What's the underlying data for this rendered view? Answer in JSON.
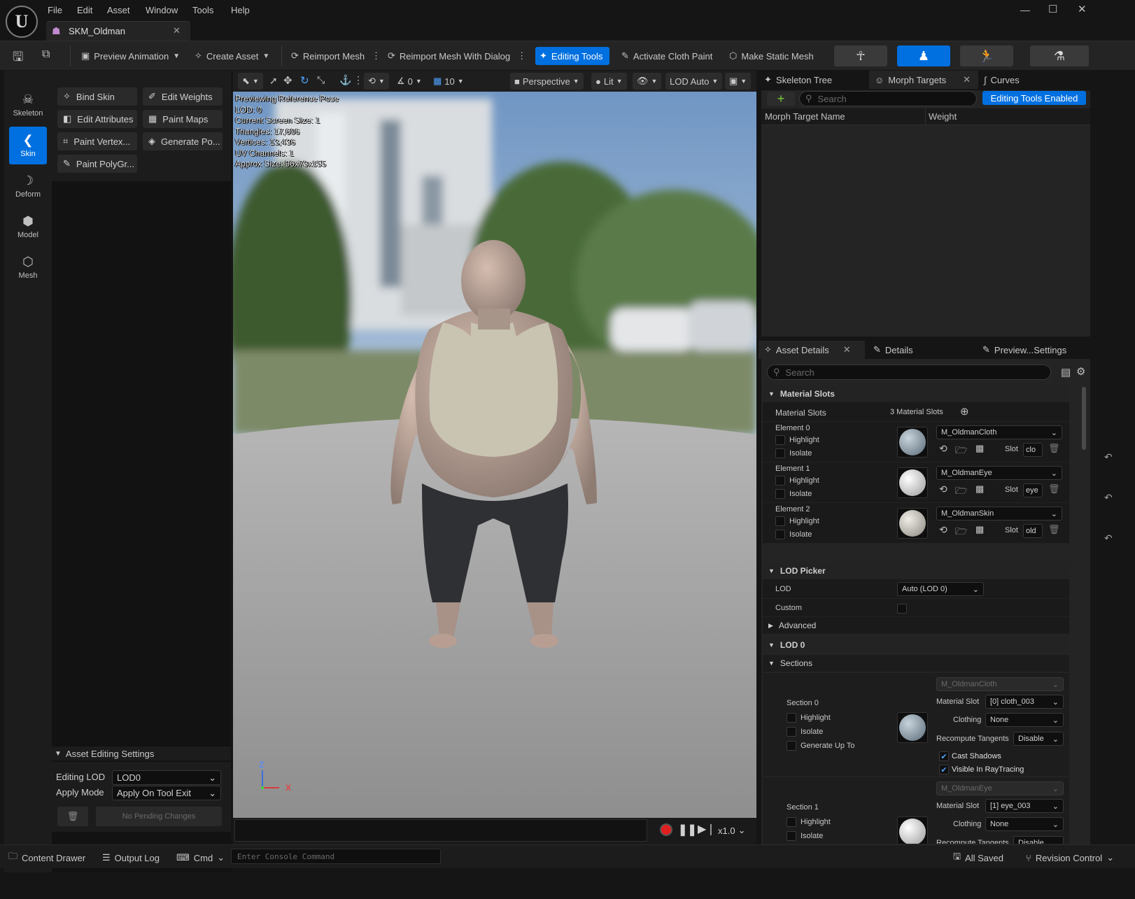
{
  "menu": [
    "File",
    "Edit",
    "Asset",
    "Window",
    "Tools",
    "Help"
  ],
  "window": {
    "tab_title": "SKM_Oldman"
  },
  "toolbar": {
    "preview_animation": "Preview Animation",
    "create_asset": "Create Asset",
    "reimport_mesh": "Reimport Mesh",
    "reimport_mesh_dialog": "Reimport Mesh With Dialog",
    "editing_tools": "Editing Tools",
    "activate_cloth_paint": "Activate Cloth Paint",
    "make_static_mesh": "Make Static Mesh"
  },
  "modes": [
    "Skeleton",
    "Skin",
    "Deform",
    "Model",
    "Mesh"
  ],
  "tools": [
    "Bind Skin",
    "Edit Weights",
    "Edit Attributes",
    "Paint Maps",
    "Paint Vertex...",
    "Generate Po...",
    "Paint PolyGr..."
  ],
  "asset_editing": {
    "header": "Asset Editing Settings",
    "editing_lod_label": "Editing LOD",
    "editing_lod_value": "LOD0",
    "apply_mode_label": "Apply Mode",
    "apply_mode_value": "Apply On Tool Exit",
    "pending": "No Pending Changes"
  },
  "viewport": {
    "snap_value": "0",
    "grid_value": "10",
    "perspective": "Perspective",
    "lit": "Lit",
    "lod": "LOD Auto",
    "stats": [
      "Previewing Reference Pose",
      "LOD: 0",
      "Current Screen Size: 1",
      "Triangles: 17,606",
      "Vertices: 13,436",
      "UV Channels: 1",
      "Approx Size: 96x73x155"
    ],
    "axis_z": "Z",
    "axis_x": "X",
    "speed": "x1.0"
  },
  "right_tabs": {
    "skeleton_tree": "Skeleton Tree",
    "morph_targets": "Morph Targets",
    "curves": "Curves",
    "search_placeholder": "Search",
    "editing_enabled": "Editing Tools Enabled",
    "col_name": "Morph Target Name",
    "col_weight": "Weight"
  },
  "details_tabs": {
    "asset_details": "Asset Details",
    "details": "Details",
    "preview_settings": "Preview...Settings",
    "search_placeholder": "Search"
  },
  "material_slots": {
    "header": "Material Slots",
    "label": "Material Slots",
    "count": "3 Material Slots",
    "elements": [
      {
        "name": "Element 0",
        "material": "M_OldmanCloth",
        "slot": "clo",
        "color": "#8a9aa8"
      },
      {
        "name": "Element 1",
        "material": "M_OldmanEye",
        "slot": "eye",
        "color": "#d8d8d8"
      },
      {
        "name": "Element 2",
        "material": "M_OldmanSkin",
        "slot": "old",
        "color": "#c8c8c0"
      }
    ],
    "highlight": "Highlight",
    "isolate": "Isolate",
    "slot_label": "Slot"
  },
  "lod_picker": {
    "header": "LOD Picker",
    "lod_label": "LOD",
    "lod_value": "Auto (LOD 0)",
    "custom_label": "Custom"
  },
  "advanced": "Advanced",
  "lod0": {
    "header": "LOD 0",
    "sections_label": "Sections",
    "sections": [
      {
        "name": "Section 0",
        "material": "M_OldmanCloth",
        "material_slot": "[0] cloth_003",
        "clothing": "None",
        "recompute": "Disable",
        "color": "#8a9aa8"
      },
      {
        "name": "Section 1",
        "material": "M_OldmanEye",
        "material_slot": "[1] eye_003",
        "clothing": "None",
        "recompute": "Disable",
        "color": "#d8d8d8"
      }
    ],
    "highlight": "Highlight",
    "isolate": "Isolate",
    "generate": "Generate Up To",
    "material_slot_label": "Material Slot",
    "clothing_label": "Clothing",
    "recompute_label": "Recompute Tangents",
    "cast_shadows": "Cast Shadows",
    "visible_raytracing": "Visible In RayTracing"
  },
  "status": {
    "content_drawer": "Content Drawer",
    "output_log": "Output Log",
    "cmd": "Cmd",
    "console_placeholder": "Enter Console Command",
    "all_saved": "All Saved",
    "revision_control": "Revision Control"
  },
  "colors": {
    "accent": "#0070e0",
    "background": "#151515",
    "panel": "#242424"
  }
}
